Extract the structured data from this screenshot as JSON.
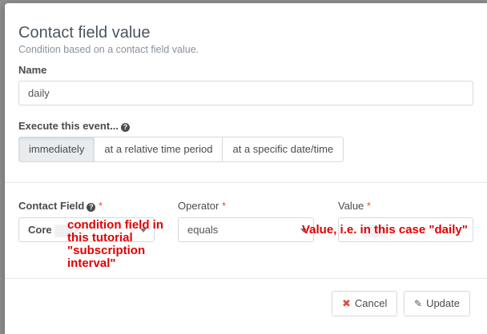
{
  "modal": {
    "title": "Contact field value",
    "subtitle": "Condition based on a contact field value."
  },
  "name": {
    "label": "Name",
    "value": "daily"
  },
  "execute": {
    "label": "Execute this event...",
    "options": [
      "immediately",
      "at a relative time period",
      "at a specific date/time"
    ],
    "selected": "immediately"
  },
  "contact_field": {
    "label": "Contact Field",
    "required_mark": "*",
    "value_prefix": "Core"
  },
  "operator": {
    "label": "Operator",
    "required_mark": "*",
    "value": "equals"
  },
  "value_field": {
    "label": "Value",
    "required_mark": "*"
  },
  "annotations": {
    "contact_field_note": "condition field in this tutorial \"subscription interval\"",
    "value_note": "Value, i.e. in this case \"daily\""
  },
  "footer": {
    "cancel_label": "Cancel",
    "update_label": "Update"
  },
  "colors": {
    "required": "#e84c3d",
    "annotation": "#e00000",
    "active_segment": "#e9ecef"
  }
}
